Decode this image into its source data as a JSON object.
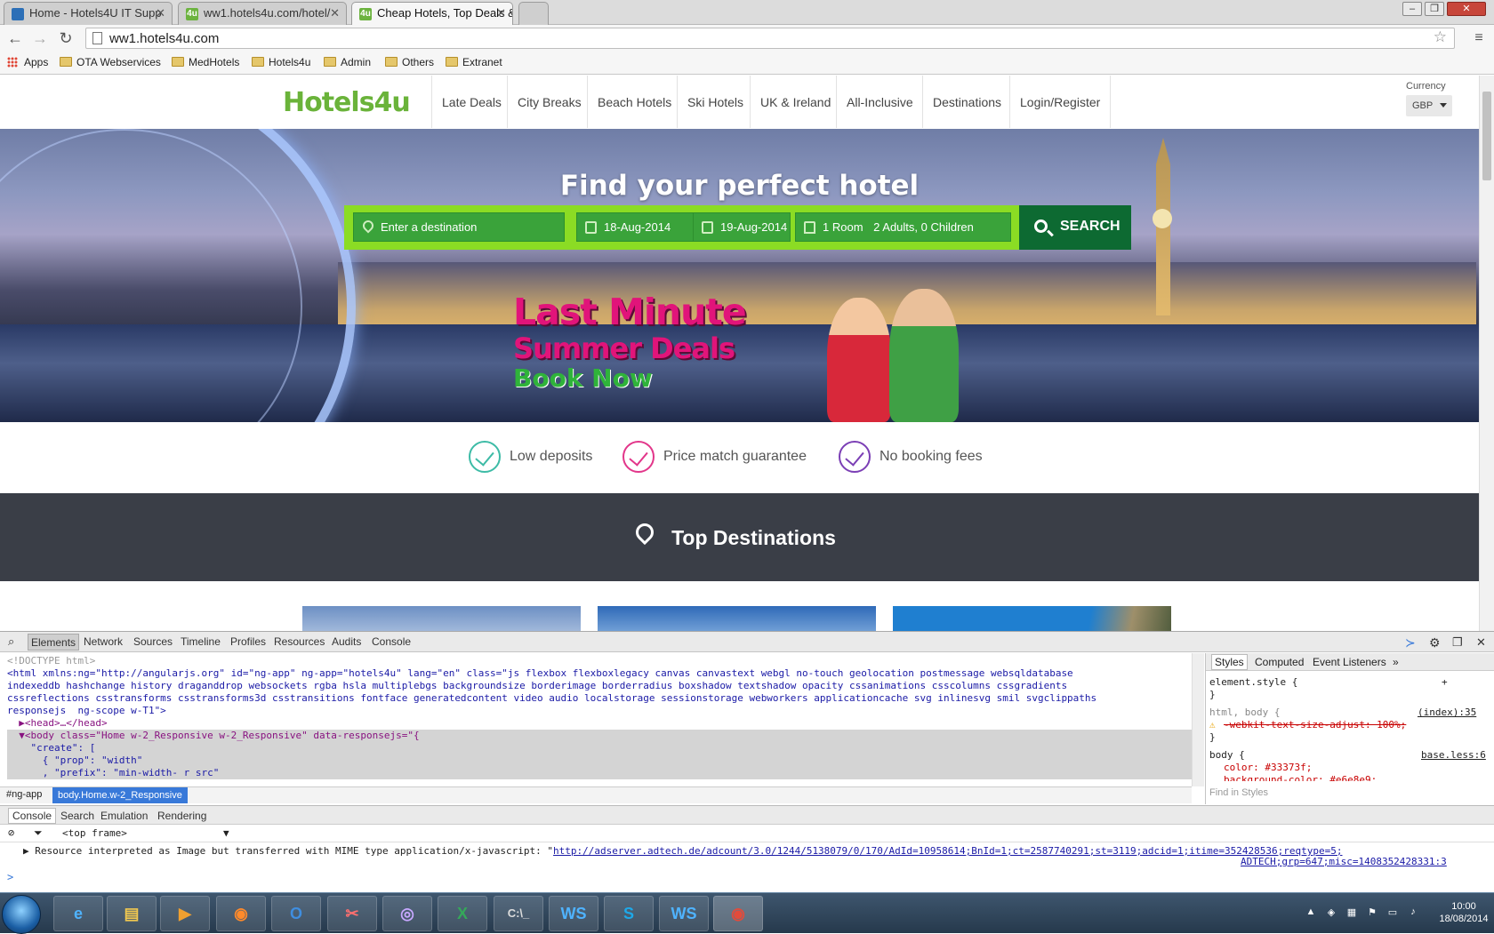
{
  "browser": {
    "tabs": [
      {
        "title": "Home - Hotels4U IT Supp",
        "icon": "document-icon"
      },
      {
        "title": "ww1.hotels4u.com/hotel/",
        "icon": "hotels4u-favicon"
      },
      {
        "title": "Cheap Hotels, Top Deals &",
        "icon": "hotels4u-favicon",
        "active": true
      }
    ],
    "url": "ww1.hotels4u.com",
    "bookmarks": [
      "Apps",
      "OTA Webservices",
      "MedHotels",
      "Hotels4u",
      "Admin",
      "Others",
      "Extranet"
    ]
  },
  "site": {
    "logo": "Hotels4u",
    "nav": [
      "Late Deals",
      "City Breaks",
      "Beach Hotels",
      "Ski Hotels",
      "UK & Ireland",
      "All-Inclusive",
      "Destinations",
      "Login/Register"
    ],
    "currency_label": "Currency",
    "currency_value": "GBP",
    "hero_title": "Find your perfect hotel",
    "search": {
      "destination_placeholder": "Enter a destination",
      "checkin": "18-Aug-2014",
      "checkout": "19-Aug-2014",
      "rooms": "1 Room",
      "guests": "2 Adults, 0 Children",
      "button": "SEARCH"
    },
    "promo": {
      "line1": "Last Minute",
      "line2": "Summer Deals",
      "line3": "Book Now"
    },
    "usps": [
      {
        "label": "Low deposits",
        "color": "#3dbba6"
      },
      {
        "label": "Price match guarantee",
        "color": "#e2368a"
      },
      {
        "label": "No booking fees",
        "color": "#7b3fb5"
      }
    ],
    "top_destinations": "Top Destinations"
  },
  "devtools": {
    "tabs": [
      "Elements",
      "Network",
      "Sources",
      "Timeline",
      "Profiles",
      "Resources",
      "Audits",
      "Console"
    ],
    "elements_lines": [
      "<!DOCTYPE html>",
      "<html xmlns:ng=\"http://angularjs.org\" id=\"ng-app\" ng-app=\"hotels4u\" lang=\"en\" class=\"js flexbox flexboxlegacy canvas canvastext webgl no-touch geolocation postmessage websqldatabase",
      "indexeddb hashchange history draganddrop websockets rgba hsla multiplebgs backgroundsize borderimage borderradius boxshadow textshadow opacity cssanimations csscolumns cssgradients",
      "cssreflections csstransforms csstransforms3d csstransitions fontface generatedcontent video audio localstorage sessionstorage webworkers applicationcache svg inlinesvg smil svgclippaths",
      "responsejs  ng-scope w-T1\">",
      "  ▶<head>…</head>",
      "  ▼<body class=\"Home w-2_Responsive w-2_Responsive\" data-responsejs=\"{",
      "    \"create\": [",
      "      { \"prop\": \"width\"",
      "      , \"prefix\": \"min-width- r src\""
    ],
    "breadcrumb": [
      "#ng-app",
      "body.Home.w-2_Responsive"
    ],
    "styles_tabs": [
      "Styles",
      "Computed",
      "Event Listeners"
    ],
    "styles_lines": [
      "element.style {",
      "}",
      "html, body {",
      "-webkit-text-size-adjust: 100%;",
      "}",
      "body {",
      "color: #33373f;",
      "background-color: #e6e8e9;"
    ],
    "styles_sources": [
      "(index):35",
      "base.less:6"
    ],
    "styles_find": "Find in Styles",
    "drawer_tabs": [
      "Console",
      "Search",
      "Emulation",
      "Rendering"
    ],
    "frame": "<top frame>",
    "console_message": "Resource interpreted as Image but transferred with MIME type application/x-javascript: \"",
    "console_link": "http://adserver.adtech.de/adcount/3.0/1244/5138079/0/170/AdId=10958614;BnId=1;ct=2587740291;st=3119;adcid=1;itime=352428536;reqtype=5;",
    "console_link2": "ADTECH;grp=647;misc=1408352428331:3",
    "prompt": ">"
  },
  "taskbar": {
    "time": "10:00",
    "date": "18/08/2014"
  }
}
